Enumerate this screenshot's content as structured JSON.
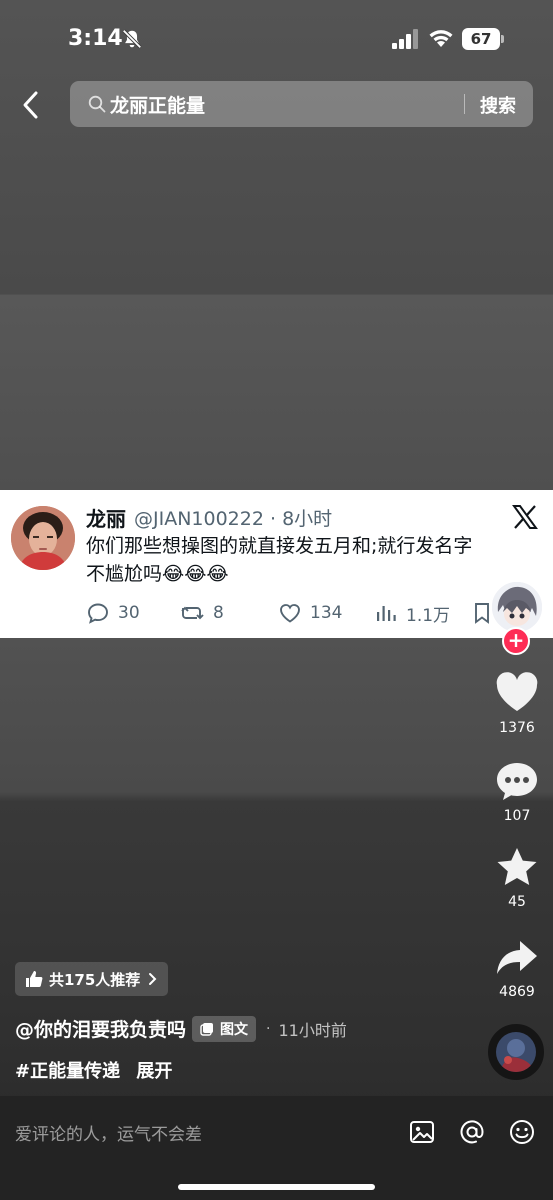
{
  "status_bar": {
    "time": "3:14",
    "battery": "67"
  },
  "search": {
    "query": "龙丽正能量",
    "button_label": "搜索"
  },
  "tweet": {
    "name": "龙丽",
    "handle": "@JIAN100222 · 8小时",
    "text_line1": "你们那些想操图的就直接发五月和;就行发名字",
    "text_line2": "不尴尬吗😂😂😂",
    "replies": "30",
    "retweets": "8",
    "likes": "134",
    "views": "1.1万"
  },
  "rail": {
    "likes": "1376",
    "comments": "107",
    "favorites": "45",
    "shares": "4869",
    "follow_symbol": "+"
  },
  "post": {
    "recommend_text": "共175人推荐",
    "author": "@你的泪要我负责吗",
    "type_tag": "图文",
    "separator": "·",
    "time": "11小时前",
    "hashtag": "#正能量传递",
    "expand": "展开"
  },
  "comment_bar": {
    "placeholder": "爱评论的人，运气不会差"
  },
  "colors": {
    "accent_red": "#fe2c55",
    "tweet_text": "#0f1419",
    "tweet_meta": "#536471"
  }
}
